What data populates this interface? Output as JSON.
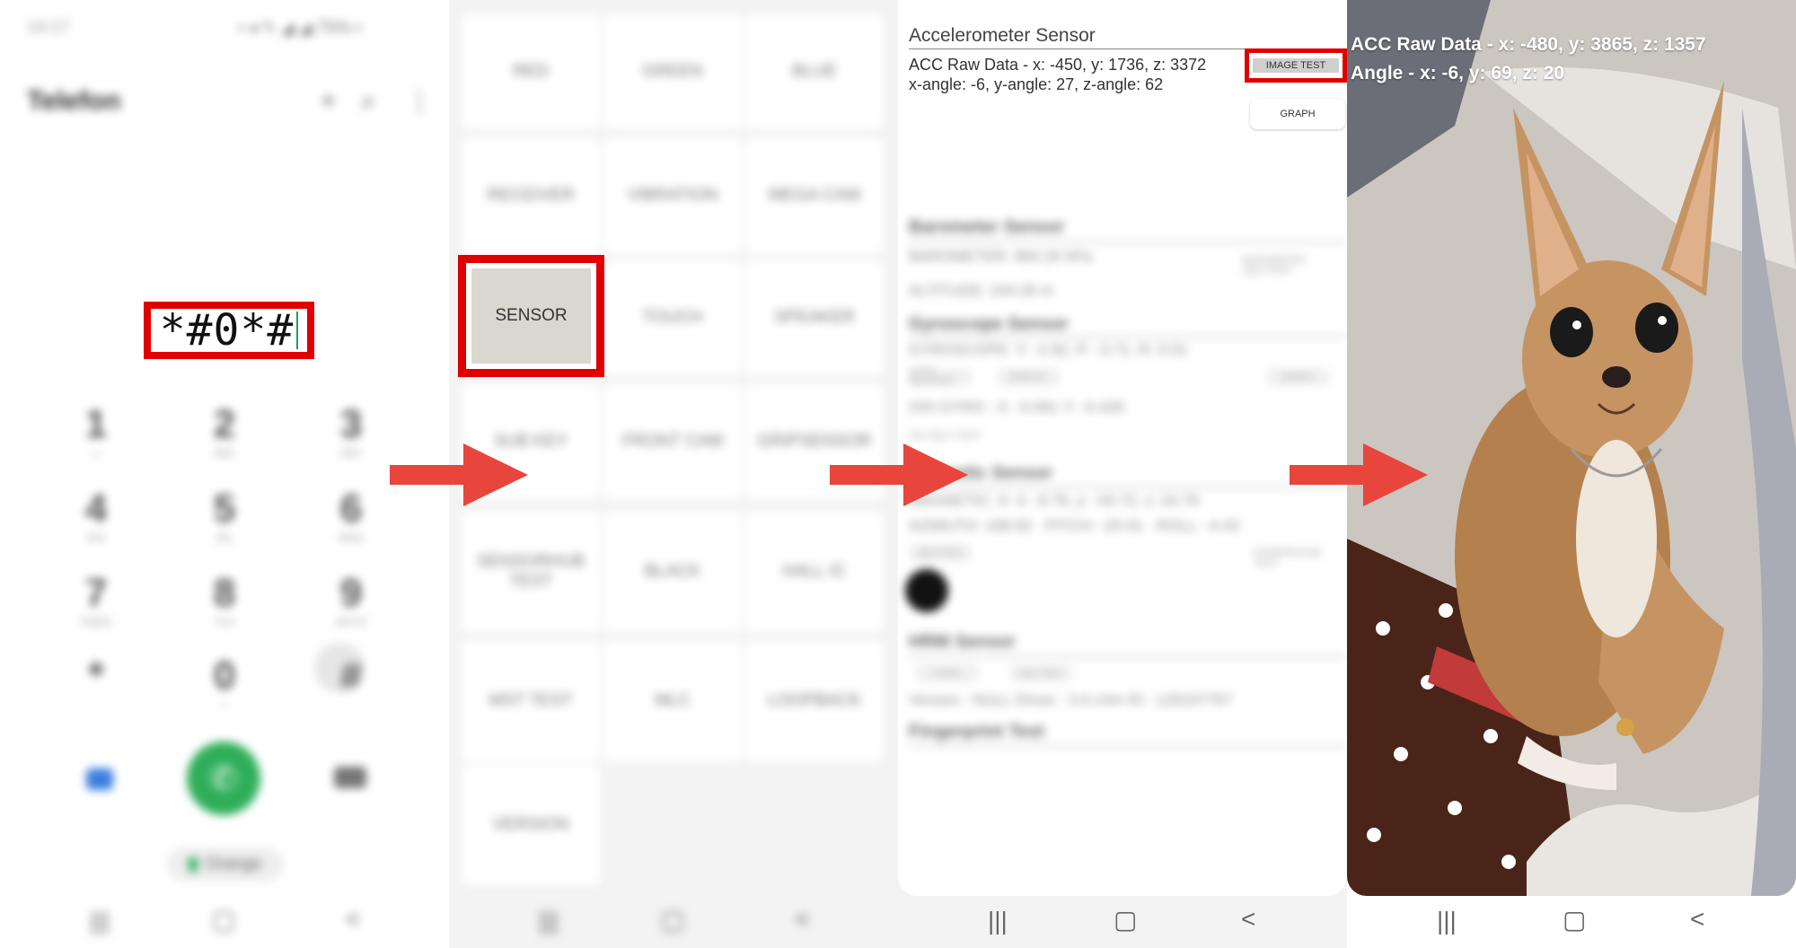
{
  "dialer": {
    "status_time": "14:17",
    "status_right": "▪ ◂ ✎ ◢ ◢ 75% ▪",
    "title": "Telefon",
    "add_icon": "+",
    "search_icon": "⌕",
    "more_icon": "⋮",
    "code": "*#0*#",
    "keys": [
      {
        "digit": "1",
        "sub": "∞"
      },
      {
        "digit": "2",
        "sub": "ABC"
      },
      {
        "digit": "3",
        "sub": "DEF"
      },
      {
        "digit": "4",
        "sub": "GHI"
      },
      {
        "digit": "5",
        "sub": "JKL"
      },
      {
        "digit": "6",
        "sub": "MNO"
      },
      {
        "digit": "7",
        "sub": "PQRS"
      },
      {
        "digit": "8",
        "sub": "TUV"
      },
      {
        "digit": "9",
        "sub": "WXYZ"
      },
      {
        "digit": "*",
        "sub": ""
      },
      {
        "digit": "0",
        "sub": "+"
      },
      {
        "digit": "#",
        "sub": ""
      }
    ],
    "call_icon": "✆",
    "carrier": "Orange"
  },
  "nav": {
    "recent": "|||",
    "home": "▢",
    "back": "<"
  },
  "test_menu": {
    "tiles": [
      "RED",
      "GREEN",
      "BLUE",
      "RECEIVER",
      "VIBRATION",
      "MEGA CAM",
      "SENSOR",
      "TOUCH",
      "SPEAKER",
      "SUB KEY",
      "FRONT CAM",
      "GRIPSENSOR",
      "SENSORHUB TEST",
      "BLACK",
      "HALL IC",
      "MST TEST",
      "MLC",
      "LOOPBACK",
      "VERSION"
    ]
  },
  "sensor_screen": {
    "acc_title": "Accelerometer Sensor",
    "acc_raw": "ACC Raw Data - x: -450, y: 1736, z: 3372",
    "acc_angle": "x-angle: -6, y-angle: 27, z-angle: 62",
    "image_test_label": "IMAGE TEST",
    "graph_label": "GRAPH",
    "barometer_title": "Barometer Sensor",
    "barometer_value": "BAROMETER: 984.26 hPa",
    "barometer_selftest": "BAROMETER SELFTEST",
    "altitude": "ALTITUDE: 244.26 m",
    "gyro_title": "Gyroscope Sensor",
    "gyro_value": "GYROSCOPE: Y: -2.92, P: -3.71, R: 0.01",
    "gyro_selftest": "GYRO SELFTEST",
    "gyro_display": "DISPLAY",
    "gyro_graph": "GRAPH",
    "ois_gyro": "OIS GYRO : X: -0.061 Y: -0.429",
    "ois_selftest": "OIS SELF TEST",
    "mag_title": "Magnetic Sensor",
    "mag_value": "MAGNETIC: X: 4.  -9.78, y: -33.72, z: 24.78",
    "azimuth": "AZIMUTH: 168.92 · PITCH: -25.01 · ROLL: -4.42",
    "mag_selftest": "SELFTEST",
    "mag_power": "POWERNOISE TEST",
    "hrm_title": "HRM Sensor",
    "hrm_start": "START",
    "hrm_eol": "EOL TEST",
    "hrm_version": "Version : NULL  Driver : 3.0.14m  ID : 126107767",
    "fingerprint_title": "Fingerprint Test"
  },
  "image_test": {
    "acc_raw": "ACC Raw Data - x: -480, y: 3865, z: 1357",
    "angle": "Angle - x: -6, y: 69, z: 20"
  }
}
